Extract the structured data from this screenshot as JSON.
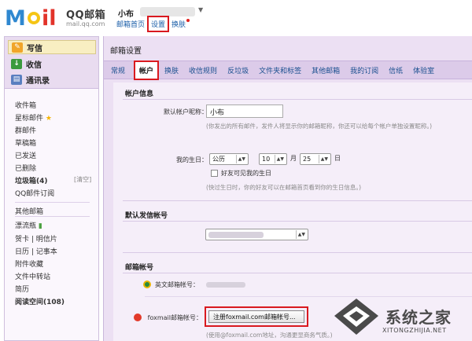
{
  "header": {
    "logo_text": "Mail",
    "brand_name": "QQ邮箱",
    "brand_domain": "mail.qq.com",
    "user_name": "小布",
    "links": [
      "邮箱首页",
      "设置",
      "换肤"
    ]
  },
  "sidebar": {
    "write": "写信",
    "receive": "收信",
    "contacts": "通讯录",
    "folders": [
      "收件箱",
      "星标邮件",
      "群邮件",
      "草稿箱",
      "已发送",
      "已删除",
      "垃圾箱(4)",
      "QQ邮件订阅",
      "其他邮箱",
      "漂流瓶",
      "贺卡 | 明信片",
      "日历 | 记事本",
      "附件收藏",
      "文件中转站",
      "简历",
      "阅读空间(108)"
    ],
    "clear_label": "[清空]"
  },
  "main": {
    "title": "邮箱设置",
    "tabs": [
      "常规",
      "帐户",
      "换肤",
      "收信规则",
      "反垃圾",
      "文件夹和标签",
      "其他邮箱",
      "我的订阅",
      "信纸",
      "体验室"
    ],
    "active_tab": "帐户"
  },
  "account_info": {
    "section_title": "帐户信息",
    "nickname_label": "默认帐户昵称：",
    "nickname_value": "小布",
    "nickname_hint": "(你发出的所有邮件，发件人将显示你的邮箱昵称，你还可以给每个帐户单独设置昵称。)",
    "birthday_label": "我的生日：",
    "calendar_type": "公历",
    "month": "10",
    "month_unit": "月",
    "day": "25",
    "day_unit": "日",
    "birthday_visible_label": "好友可见我的生日",
    "birthday_hint": "(快过生日时，你的好友可以在邮箱首页看到你的生日信息。)"
  },
  "default_sender": {
    "section_title": "默认发信帐号"
  },
  "mail_accounts": {
    "section_title": "邮箱帐号",
    "english_label": "英文邮箱帐号：",
    "foxmail_label": "foxmail邮箱帐号：",
    "register_button": "注册foxmail.com邮箱帐号...",
    "foxmail_hint": "(使用@foxmail.com地址，沟通更显商务气质。)"
  },
  "watermark": {
    "text": "系统之家",
    "sub": "XITONGZHIJIA.NET"
  },
  "colors": {
    "accent_red": "#d9191f",
    "tab_bar": "#dccbe9",
    "panel": "#f5eef9",
    "link": "#1a5ea8"
  }
}
